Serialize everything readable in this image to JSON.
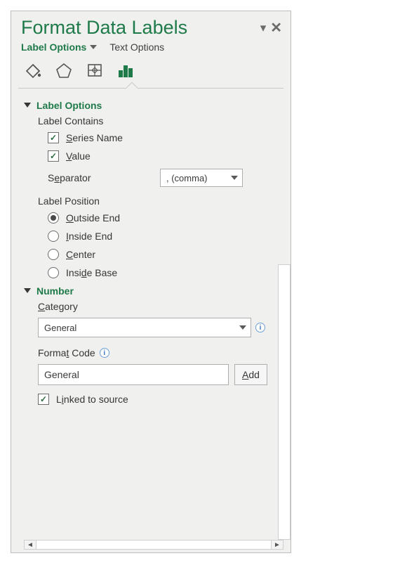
{
  "title": "Format Data Labels",
  "tabs": {
    "label_options": "Label Options",
    "text_options": "Text Options"
  },
  "sections": {
    "label_options": {
      "header": "Label Options",
      "label_contains": "Label Contains",
      "series_name": "Series Name",
      "value": "Value",
      "separator_label": "Separator",
      "separator_value": ", (comma)",
      "label_position": "Label Position",
      "outside_end": "Outside End",
      "inside_end": "Inside End",
      "center": "Center",
      "inside_base": "Inside Base"
    },
    "number": {
      "header": "Number",
      "category_label": "Category",
      "category_value": "General",
      "format_code_label": "Format Code",
      "format_code_value": "General",
      "add_button": "Add",
      "linked": "Linked to source"
    }
  }
}
